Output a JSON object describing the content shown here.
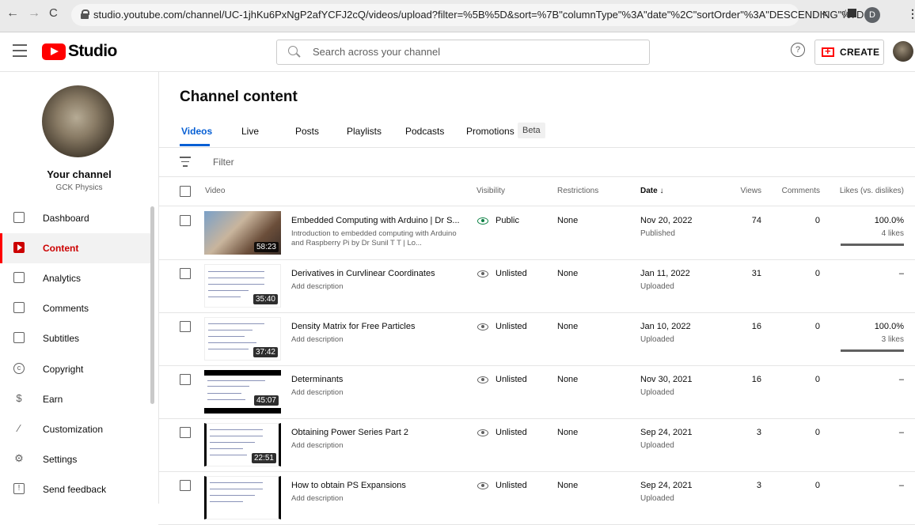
{
  "browser": {
    "url": "studio.youtube.com/channel/UC-1jhKu6PxNgP2afYCFJ2cQ/videos/upload?filter=%5B%5D&sort=%7B\"columnType\"%3A\"date\"%2C\"sortOrder\"%3A\"DESCENDING\"%7D",
    "profile_initial": "D"
  },
  "header": {
    "logo_text": "Studio",
    "search_placeholder": "Search across your channel",
    "help_label": "?",
    "create_label": "CREATE"
  },
  "channel": {
    "title": "Your channel",
    "name": "GCK Physics"
  },
  "sidebar": {
    "items": [
      {
        "label": "Dashboard",
        "icon": "dashboard-icon"
      },
      {
        "label": "Content",
        "icon": "content-icon",
        "active": true
      },
      {
        "label": "Analytics",
        "icon": "analytics-icon"
      },
      {
        "label": "Comments",
        "icon": "comments-icon"
      },
      {
        "label": "Subtitles",
        "icon": "subtitles-icon"
      },
      {
        "label": "Copyright",
        "icon": "copyright-icon"
      },
      {
        "label": "Earn",
        "icon": "earn-icon"
      },
      {
        "label": "Customization",
        "icon": "customization-icon"
      },
      {
        "label": "Settings",
        "icon": "settings-icon"
      },
      {
        "label": "Send feedback",
        "icon": "feedback-icon"
      }
    ]
  },
  "page": {
    "title": "Channel content",
    "tabs": [
      "Videos",
      "Live",
      "Posts",
      "Playlists",
      "Podcasts",
      "Promotions"
    ],
    "beta_badge": "Beta",
    "filter_label": "Filter"
  },
  "table": {
    "columns": {
      "video": "Video",
      "visibility": "Visibility",
      "restrictions": "Restrictions",
      "date": "Date ↓",
      "views": "Views",
      "comments": "Comments",
      "likes": "Likes (vs. dislikes)"
    },
    "rows": [
      {
        "title": "Embedded Computing with Arduino | Dr S...",
        "description": "Introduction to embedded computing with Arduino and Raspberry Pi by Dr Sunil T T | Lo...",
        "duration": "58:23",
        "visibility": "Public",
        "restrictions": "None",
        "date": "Nov 20, 2022",
        "status": "Published",
        "views": "74",
        "comments": "0",
        "likes": "100.0%",
        "likes_count": "4 likes",
        "like_ratio": 1.0
      },
      {
        "title": "Derivatives in Curvlinear Coordinates",
        "description": "Add description",
        "duration": "35:40",
        "visibility": "Unlisted",
        "restrictions": "None",
        "date": "Jan 11, 2022",
        "status": "Uploaded",
        "views": "31",
        "comments": "0",
        "likes": "–",
        "likes_count": "",
        "like_ratio": null
      },
      {
        "title": "Density Matrix for Free Particles",
        "description": "Add description",
        "duration": "37:42",
        "visibility": "Unlisted",
        "restrictions": "None",
        "date": "Jan 10, 2022",
        "status": "Uploaded",
        "views": "16",
        "comments": "0",
        "likes": "100.0%",
        "likes_count": "3 likes",
        "like_ratio": 1.0
      },
      {
        "title": "Determinants",
        "description": "Add description",
        "duration": "45:07",
        "visibility": "Unlisted",
        "restrictions": "None",
        "date": "Nov 30, 2021",
        "status": "Uploaded",
        "views": "16",
        "comments": "0",
        "likes": "–",
        "likes_count": "",
        "like_ratio": null
      },
      {
        "title": "Obtaining Power Series Part 2",
        "description": "Add description",
        "duration": "22:51",
        "visibility": "Unlisted",
        "restrictions": "None",
        "date": "Sep 24, 2021",
        "status": "Uploaded",
        "views": "3",
        "comments": "0",
        "likes": "–",
        "likes_count": "",
        "like_ratio": null
      },
      {
        "title": "How to obtain PS Expansions",
        "description": "Add description",
        "duration": "",
        "visibility": "Unlisted",
        "restrictions": "None",
        "date": "Sep 24, 2021",
        "status": "Uploaded",
        "views": "3",
        "comments": "0",
        "likes": "–",
        "likes_count": "",
        "like_ratio": null
      }
    ]
  },
  "colors": {
    "accent": "#065fd4",
    "brand": "#ff0000",
    "public": "#0b8043"
  }
}
